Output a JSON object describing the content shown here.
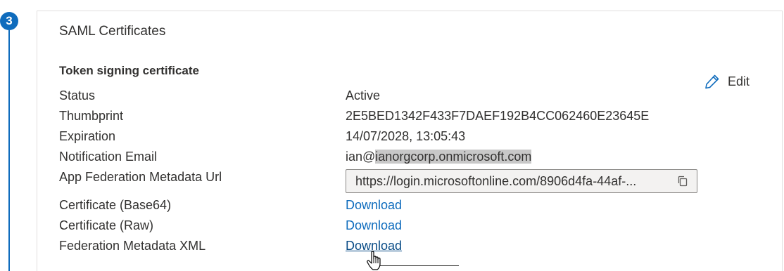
{
  "step": {
    "number": "3"
  },
  "card": {
    "title": "SAML Certificates",
    "section_title": "Token signing certificate",
    "edit_label": "Edit"
  },
  "rows": {
    "status": {
      "label": "Status",
      "value": "Active"
    },
    "thumbprint": {
      "label": "Thumbprint",
      "value": "2E5BED1342F433F7DAEF192B4CC062460E23645E"
    },
    "expiration": {
      "label": "Expiration",
      "value": "14/07/2028, 13:05:43"
    },
    "notification_email": {
      "label": "Notification Email",
      "value_prefix": "ian@",
      "value_highlighted": "ianorgcorp.onmicrosoft.com"
    },
    "metadata_url": {
      "label": "App Federation Metadata Url",
      "value": "https://login.microsoftonline.com/8906d4fa-44af-..."
    },
    "cert_base64": {
      "label": "Certificate (Base64)",
      "link": "Download"
    },
    "cert_raw": {
      "label": "Certificate (Raw)",
      "link": "Download"
    },
    "federation_xml": {
      "label": "Federation Metadata XML",
      "link": "Download"
    }
  },
  "icons": {
    "edit": "pencil-icon",
    "copy": "copy-icon",
    "cursor": "hand-pointer-icon"
  },
  "colors": {
    "accent": "#0f6cbd",
    "link": "#0f6cbd",
    "highlight": "#c8c8c8"
  }
}
